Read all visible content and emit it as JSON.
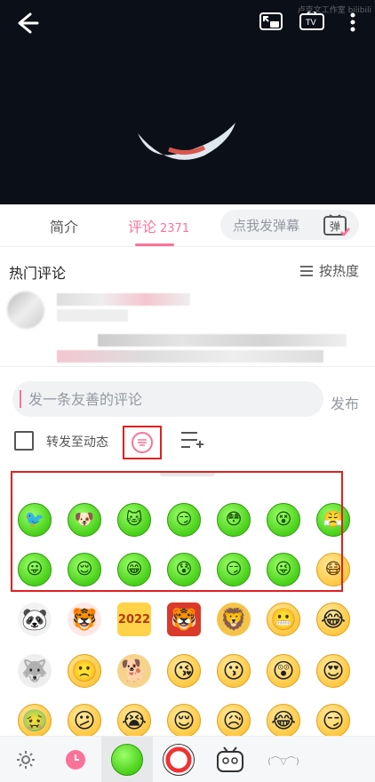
{
  "video": {
    "watermark": "卢克文工作室 bilibili"
  },
  "tabs": {
    "intro": "简介",
    "comments": "评论",
    "comment_count": "2371",
    "danmu_placeholder": "点我发弹幕",
    "danmu_icon_text": "弹"
  },
  "hot_comments": {
    "title": "热门评论",
    "sort_label": "按热度"
  },
  "input": {
    "placeholder": "发一条友善的评论",
    "publish": "发布",
    "repost_label": "转发至动态"
  },
  "emoji_panel": {
    "row1": [
      "🐦",
      "🐶",
      "🐱",
      "😏",
      "😳",
      "😵",
      "😤"
    ],
    "row2": [
      "😛",
      "😌",
      "😁",
      "😰",
      "😏",
      "😜",
      "😷"
    ],
    "row3": [
      "🐼",
      "🐯",
      "2022",
      "🐯",
      "🦁",
      "😬",
      "😂"
    ],
    "row4": [
      "🐺",
      "🙁",
      "🐕",
      "😘",
      "😗",
      "😲",
      "😍"
    ],
    "row5": [
      "🤢",
      "😕",
      "😭",
      "😌",
      "😥",
      "😂",
      "😏"
    ]
  },
  "bottombar": {
    "kaomoji": "(⌒▽⌒)"
  }
}
